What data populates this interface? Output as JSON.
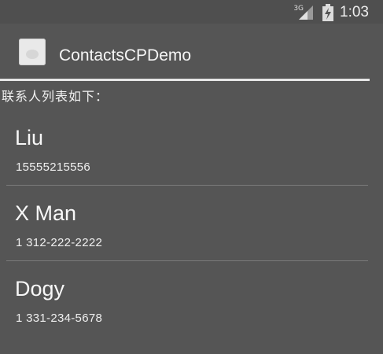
{
  "status_bar": {
    "network_type": "3G",
    "time": "1:03",
    "icons": [
      "signal-icon",
      "battery-charging-icon"
    ]
  },
  "action_bar": {
    "app_icon": "app-launcher-icon",
    "title": "ContactsCPDemo"
  },
  "list_header": "联系人列表如下：",
  "contacts": [
    {
      "name": "Liu",
      "phone": "15555215556"
    },
    {
      "name": "X Man",
      "phone": "1 312-222-2222"
    },
    {
      "name": "Dogy",
      "phone": "1 331-234-5678"
    }
  ],
  "colors": {
    "background": "#555555",
    "status_bar": "#4f4f4f",
    "text": "#f2f2f2",
    "divider": "#7a7a7a",
    "action_divider": "#e6e6e6"
  }
}
